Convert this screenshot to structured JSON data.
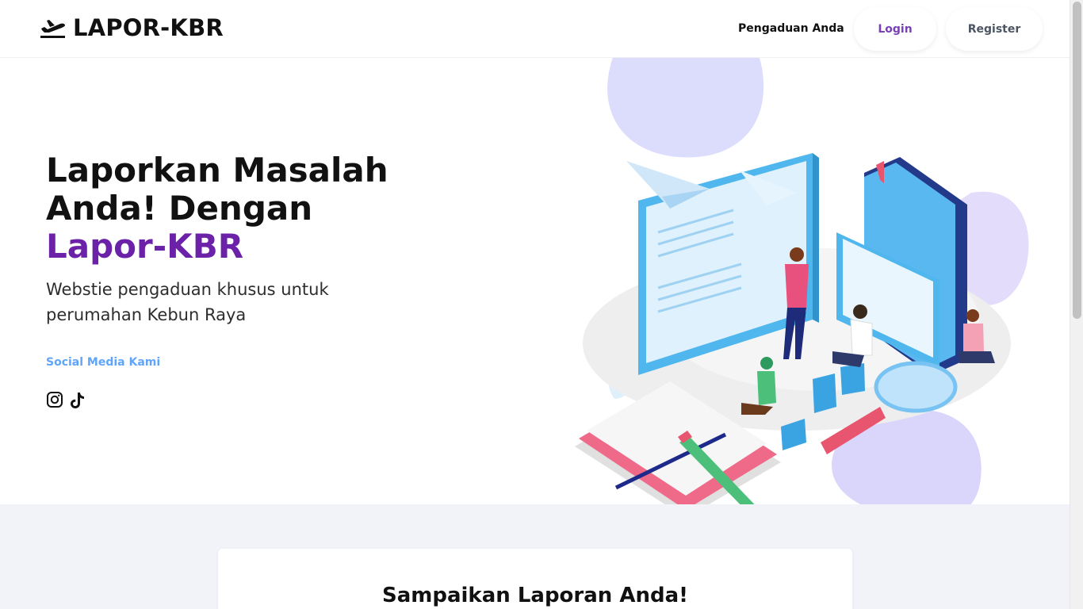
{
  "navbar": {
    "brand": "LAPOR-KBR",
    "link_pengaduan": "Pengaduan Anda",
    "login": "Login",
    "register": "Register"
  },
  "hero": {
    "title_part1": "Laporkan Masalah Anda! Dengan ",
    "title_accent": "Lapor-KBR",
    "subtitle": "Webstie pengaduan khusus untuk perumahan Kebun Raya",
    "social_label": "Social Media Kami",
    "social_icons": [
      "instagram-icon",
      "tiktok-icon"
    ]
  },
  "report_section": {
    "title": "Sampaikan Laporan Anda!"
  },
  "colors": {
    "accent_purple": "#6b21a8",
    "social_blue": "#60a5fa",
    "lower_bg": "#f1f3f8"
  }
}
